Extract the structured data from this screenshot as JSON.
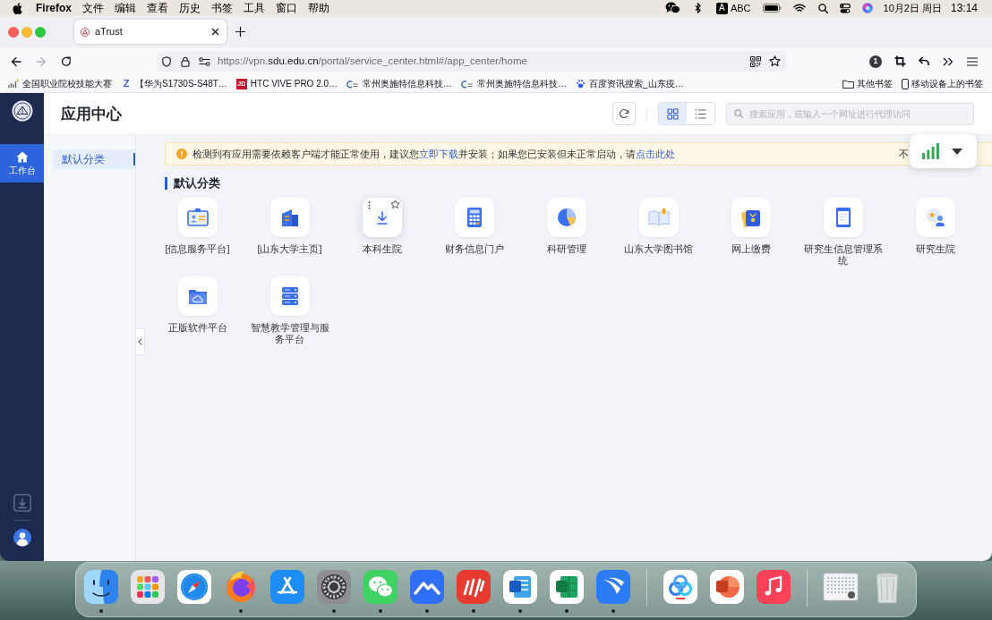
{
  "menu_bar": {
    "app_name": "Firefox",
    "menus": [
      "文件",
      "编辑",
      "查看",
      "历史",
      "书签",
      "工具",
      "窗口",
      "帮助"
    ],
    "input_source": {
      "badge": "A",
      "label": "ABC"
    },
    "date": "10月2日 周日",
    "time": "13:14"
  },
  "browser": {
    "tabs": [
      {
        "title": "aTrust",
        "selected": true
      }
    ],
    "nav_buttons": [
      {
        "disabled": false
      },
      {
        "disabled": true
      },
      {
        "disabled": false
      }
    ],
    "url": {
      "prefix": "https://vpn.",
      "domain": "sdu.edu.cn",
      "path": "/portal/service_center.html#/app_center/home"
    },
    "extension_badge": "1",
    "bookmarks": [
      {
        "title": "全国职业院校技能大赛"
      },
      {
        "title": "【华为S1730S-S48T…",
        "badge": "Z"
      },
      {
        "title": "HTC VIVE PRO 2.0…",
        "badge": "JD"
      },
      {
        "title": "常州奥施特信息科技…"
      },
      {
        "title": "常州奥施特信息科技…"
      },
      {
        "title": "百度资讯搜索_山东疫…"
      }
    ],
    "bookmark_folders": [
      "其他书签",
      "移动设备上的书签"
    ]
  },
  "sidebar": {
    "items": [
      {
        "label": "工作台",
        "selected": true
      }
    ]
  },
  "header": {
    "title": "应用中心",
    "views": [
      {
        "selected": true
      },
      {
        "selected": false
      }
    ],
    "search": {
      "placeholder": "搜索应用，或输入一个网址进行代理访问"
    }
  },
  "categories": [
    {
      "label": "默认分类",
      "selected": true
    }
  ],
  "notice": {
    "segments": [
      {
        "kind": "text",
        "text": "检测到有应用需要依赖客户端才能正常使用，建议您"
      },
      {
        "kind": "link",
        "text": "立即下载"
      },
      {
        "kind": "text",
        "text": "并安装；如果您已安装但未正常启动，请"
      },
      {
        "kind": "link",
        "text": "点击此处"
      }
    ],
    "dismiss": "不"
  },
  "section": {
    "title": "默认分类",
    "apps": [
      {
        "label": "[信息服务平台]",
        "hovered": false
      },
      {
        "label": "[山东大学主页]",
        "hovered": false
      },
      {
        "label": "本科生院",
        "hovered": true
      },
      {
        "label": "财务信息门户",
        "hovered": false
      },
      {
        "label": "科研管理",
        "hovered": false
      },
      {
        "label": "山东大学图书馆",
        "hovered": false
      },
      {
        "label": "网上缴费",
        "hovered": false
      },
      {
        "label": "研究生信息管理系统",
        "hovered": false
      },
      {
        "label": "研究生院",
        "hovered": false
      },
      {
        "label": "正版软件平台",
        "hovered": false
      },
      {
        "label": "智慧教学管理与服务平台",
        "hovered": false
      }
    ]
  },
  "dock": {
    "groups": [
      [
        {
          "running": true
        },
        {
          "running": false
        },
        {
          "running": false
        },
        {
          "running": true
        },
        {
          "running": false
        },
        {
          "running": true
        },
        {
          "running": true
        },
        {
          "running": true
        },
        {
          "running": true
        },
        {
          "running": true
        },
        {
          "running": true
        },
        {
          "running": true
        }
      ],
      [
        {
          "running": false
        },
        {
          "running": false
        },
        {
          "running": false
        }
      ],
      [
        {
          "running": false
        },
        {
          "running": false
        }
      ]
    ]
  }
}
